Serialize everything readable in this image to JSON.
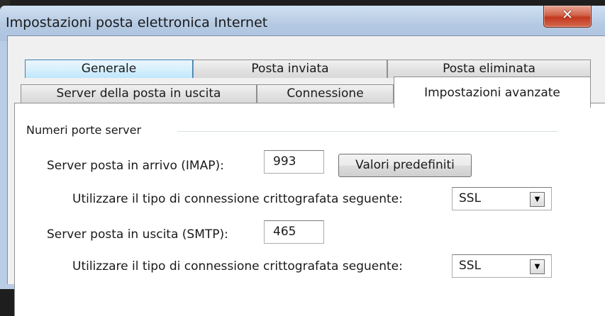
{
  "window": {
    "title": "Impostazioni posta elettronica Internet",
    "close_glyph": "✕"
  },
  "tabs": {
    "back_row": [
      "Generale",
      "Posta inviata",
      "Posta eliminata"
    ],
    "front_row": [
      "Server della posta in uscita",
      "Connessione",
      "Impostazioni avanzate"
    ],
    "active": "Impostazioni avanzate"
  },
  "server_ports": {
    "group_label": "Numeri porte server",
    "incoming_label": "Server posta in arrivo (IMAP):",
    "incoming_value": "993",
    "defaults_button": "Valori predefiniti",
    "incoming_encryption_label": "Utilizzare il tipo di connessione crittografata seguente:",
    "incoming_encryption_value": "SSL",
    "outgoing_label": "Server posta in uscita (SMTP):",
    "outgoing_value": "465",
    "outgoing_encryption_label": "Utilizzare il tipo di connessione crittografata seguente:",
    "outgoing_encryption_value": "SSL"
  },
  "icons": {
    "close": "close-icon",
    "dropdown": "dropdown-arrow-icon"
  }
}
